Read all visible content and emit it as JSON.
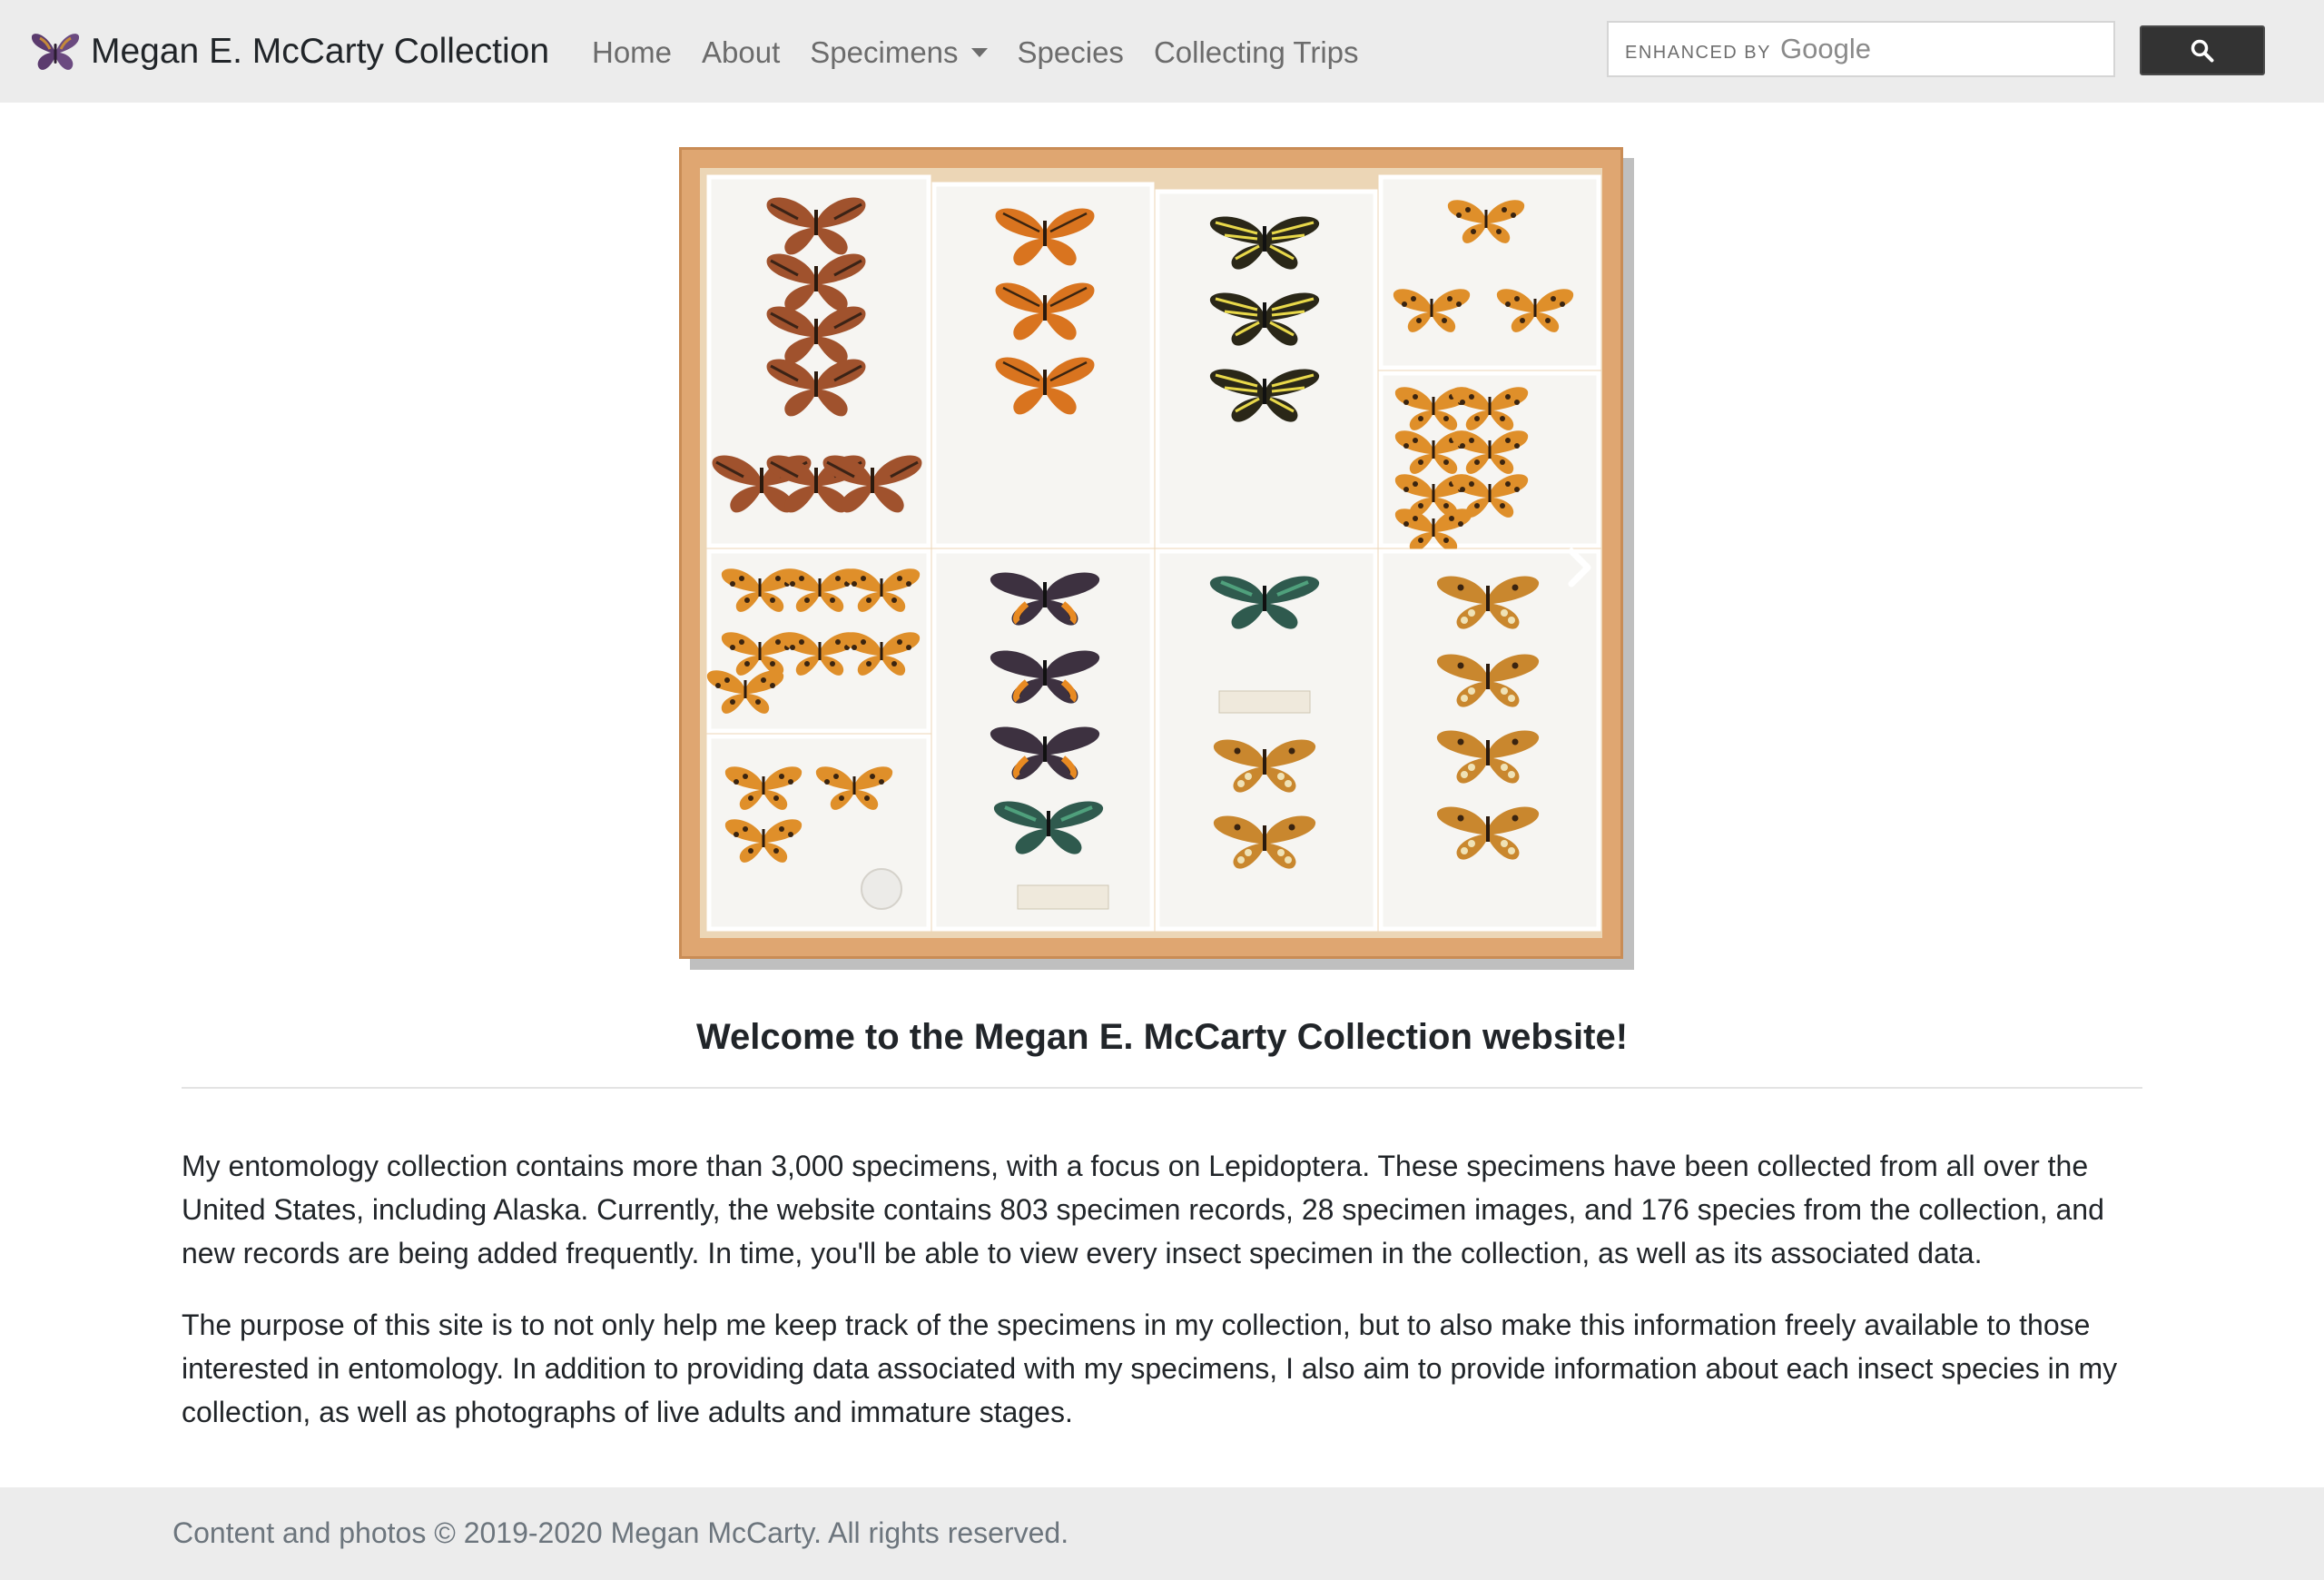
{
  "brand": {
    "title": "Megan E. McCarty Collection",
    "logo_icon": "butterfly-icon"
  },
  "nav": {
    "items": [
      {
        "label": "Home"
      },
      {
        "label": "About"
      },
      {
        "label": "Specimens",
        "has_dropdown": true
      },
      {
        "label": "Species"
      },
      {
        "label": "Collecting Trips"
      }
    ]
  },
  "search": {
    "enhanced_label": "ENHANCED BY",
    "google_label": "Google",
    "button_icon": "search-icon"
  },
  "hero": {
    "image_description_icon": "specimen-drawer-image",
    "next_icon": "chevron-right-icon"
  },
  "welcome": {
    "prefix": "Welcome to the ",
    "bold": "Megan E. McCarty Collection",
    "suffix": " website!"
  },
  "paragraphs": [
    "My entomology collection contains more than 3,000 specimens, with a focus on Lepidoptera. These specimens have been collected from all over the United States, including Alaska. Currently, the website contains 803 specimen records, 28 specimen images, and 176 species from the collection, and new records are being added frequently. In time, you'll be able to view every insect specimen in the collection, as well as its associated data.",
    "The purpose of this site is to not only help me keep track of the specimens in my collection, but to also make this information freely available to those interested in entomology. In addition to providing data associated with my specimens, I also aim to provide information about each insect species in my collection, as well as photographs of live adults and immature stages."
  ],
  "footer": {
    "text": "Content and photos © 2019-2020 Megan McCarty. All rights reserved."
  },
  "colors": {
    "navbar_bg": "#ececec",
    "search_button": "#333333",
    "drawer_wood": "#dfa671",
    "footer_text": "#6c757d"
  }
}
